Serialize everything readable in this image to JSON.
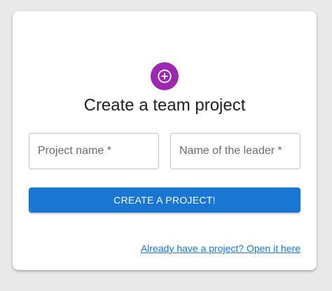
{
  "colors": {
    "accent_purple": "#9c27b0",
    "primary_blue": "#1976d2",
    "link_blue": "#1976d2"
  },
  "header": {
    "icon": "add-circle-icon",
    "title": "Create a team project"
  },
  "form": {
    "project_name_placeholder": "Project name *",
    "leader_name_placeholder": "Name of the leader *",
    "project_name_value": "",
    "leader_name_value": "",
    "submit_label": "CREATE A PROJECT!"
  },
  "footer": {
    "open_link_label": "Already have a project? Open it here"
  }
}
